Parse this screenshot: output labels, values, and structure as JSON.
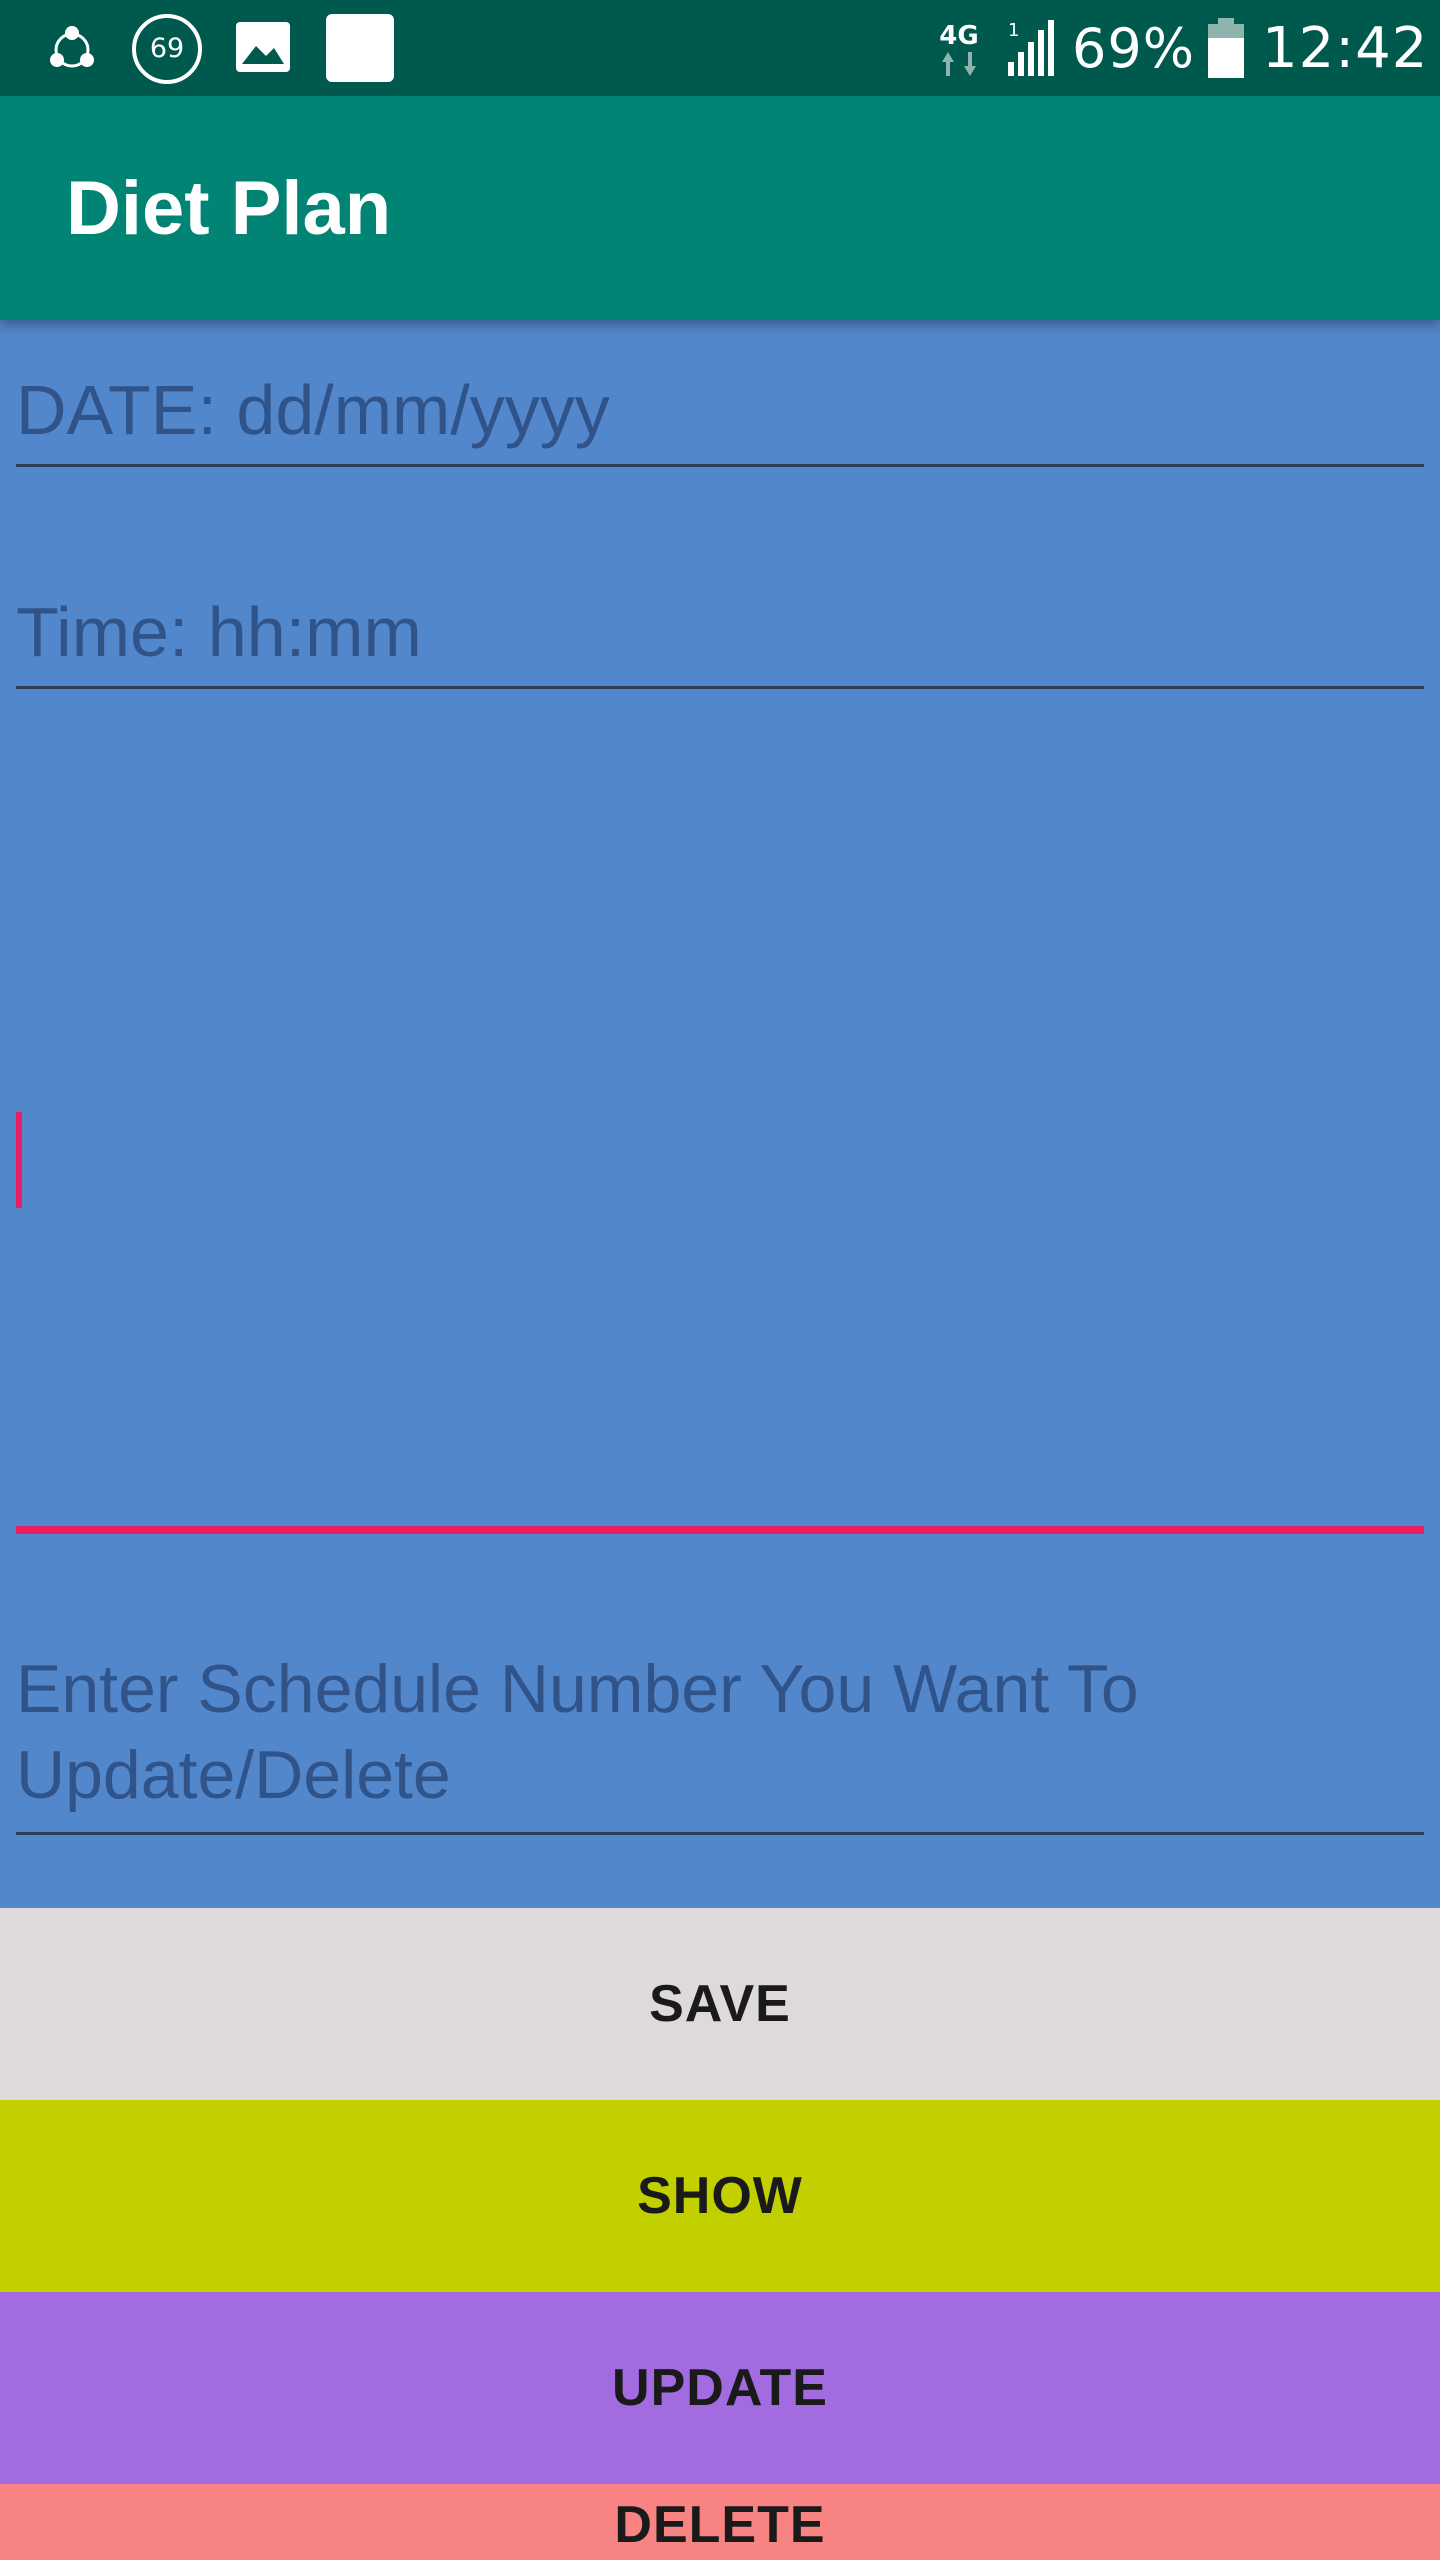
{
  "status_bar": {
    "badge_number": "69",
    "battery_percent": "69%",
    "time": "12:42",
    "network_type": "4G",
    "icons": [
      "share-icon",
      "notification-badge-icon",
      "gallery-icon",
      "app-square-icon",
      "network-4g-icon",
      "signal-icon",
      "battery-icon"
    ]
  },
  "app_bar": {
    "title": "Diet Plan"
  },
  "form": {
    "date_placeholder": "DATE: dd/mm/yyyy",
    "time_placeholder": "Time: hh:mm",
    "notes_value": "",
    "schedule_placeholder": "Enter Schedule Number You Want To Update/Delete"
  },
  "buttons": {
    "save": "SAVE",
    "show": "SHOW",
    "update": "UPDATE",
    "delete": "DELETE"
  },
  "colors": {
    "status_bar": "#00594d",
    "app_bar": "#028475",
    "background": "#5387cb",
    "accent": "#e91e63",
    "save_button": "#dddad9",
    "show_button": "#c3d000",
    "update_button": "#a26be0",
    "delete_button": "#f78382"
  }
}
